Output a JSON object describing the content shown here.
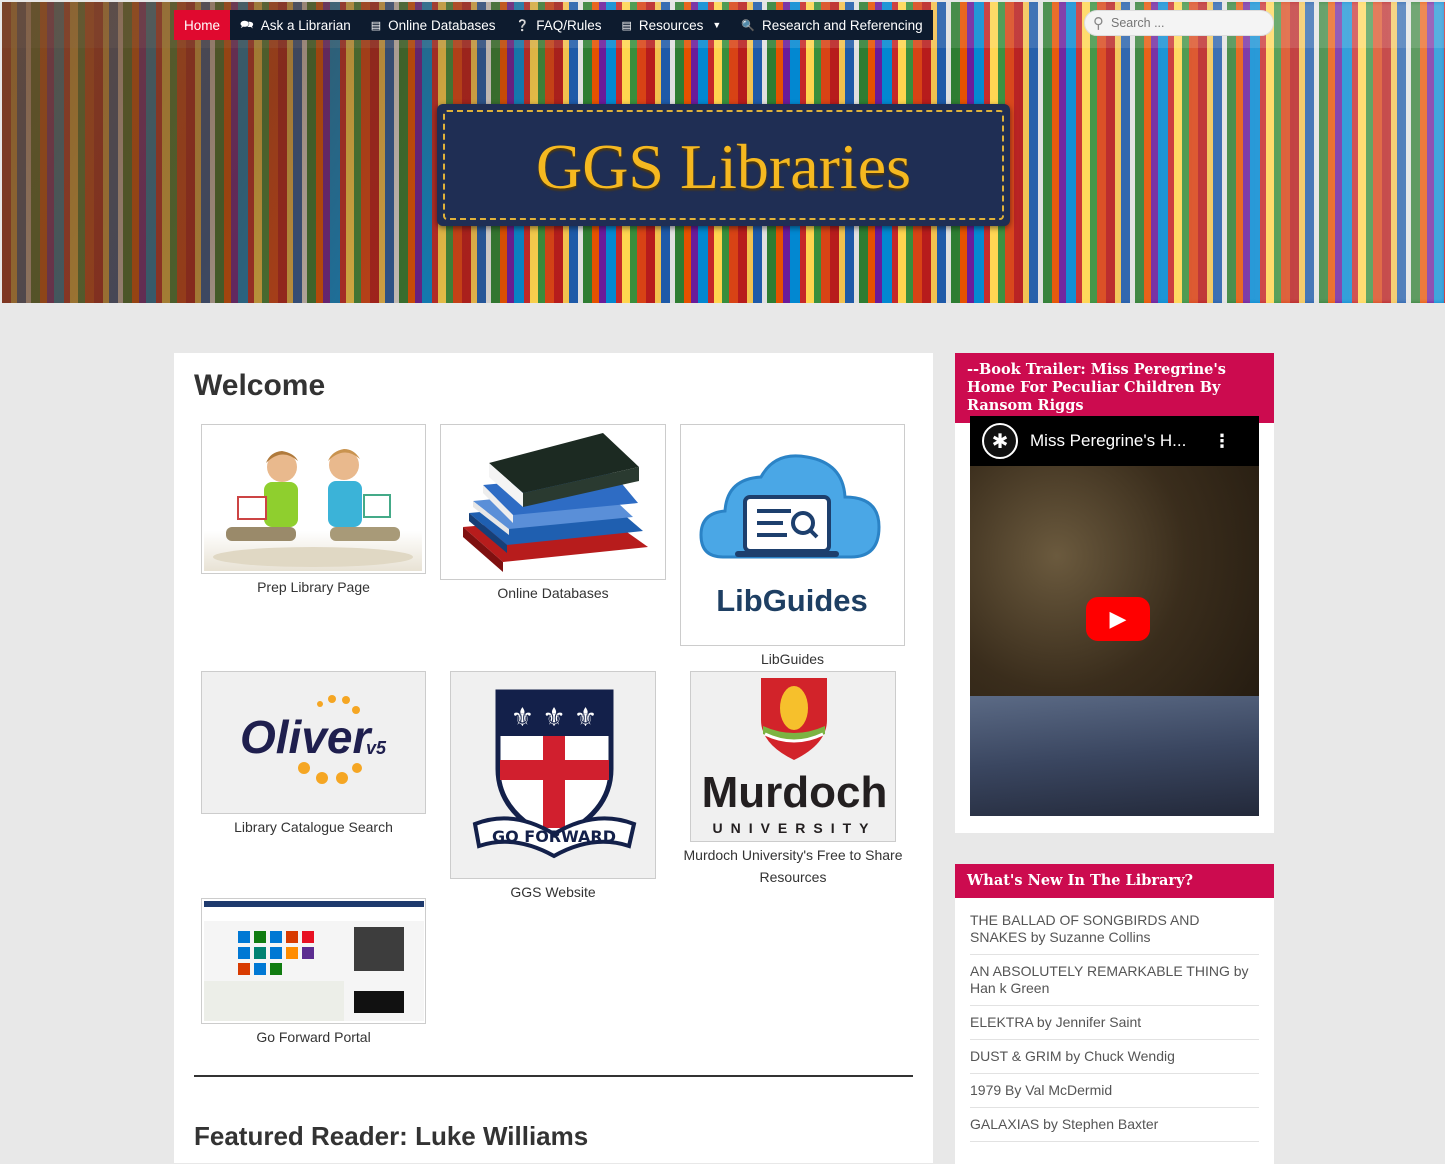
{
  "nav": {
    "items": [
      {
        "label": "Home",
        "icon": "",
        "active": true
      },
      {
        "label": "Ask a Librarian",
        "icon": "chat-icon"
      },
      {
        "label": "Online Databases",
        "icon": "database-icon"
      },
      {
        "label": "FAQ/Rules",
        "icon": "question-icon"
      },
      {
        "label": "Resources",
        "icon": "list-icon",
        "dropdown": true
      },
      {
        "label": "Research and Referencing",
        "icon": "search-icon"
      }
    ],
    "search_placeholder": "Search ..."
  },
  "header": {
    "logo_text": "GGS Libraries"
  },
  "main": {
    "title": "Welcome",
    "tiles": [
      {
        "caption": "Prep Library Page"
      },
      {
        "caption": "Online Databases"
      },
      {
        "caption": "LibGuides",
        "logo_text": "LibGuides"
      },
      {
        "caption": "Library Catalogue Search",
        "logo_text": "Oliver",
        "logo_suffix": "v5"
      },
      {
        "caption": "GGS Website",
        "motto": "GO FORWARD"
      },
      {
        "caption": "Murdoch University's Free to Share Resources",
        "logo_text": "Murdoch",
        "logo_sub": "UNIVERSITY"
      },
      {
        "caption": "Go Forward Portal"
      }
    ],
    "featured_title": "Featured Reader: Luke Williams"
  },
  "sidebar": {
    "video_widget": {
      "title": "--Book Trailer: Miss Peregrine's Home For Peculiar Children By Ransom Riggs",
      "video_title": "Miss Peregrine's H..."
    },
    "news_widget": {
      "title": "What's New In The Library?",
      "items": [
        "THE BALLAD OF SONGBIRDS AND SNAKES by Suzanne Collins",
        "AN ABSOLUTELY REMARKABLE THING by Han k Green",
        "ELEKTRA by Jennifer Saint",
        "DUST & GRIM by Chuck Wendig",
        "1979 By Val McDermid",
        "GALAXIAS by Stephen Baxter"
      ]
    }
  },
  "colors": {
    "nav_bg": "#0d1b2e",
    "nav_active": "#e0092f",
    "widget_header": "#cc0b4f",
    "logo_gold": "#f5b820",
    "logo_plate": "#1f2e54"
  }
}
